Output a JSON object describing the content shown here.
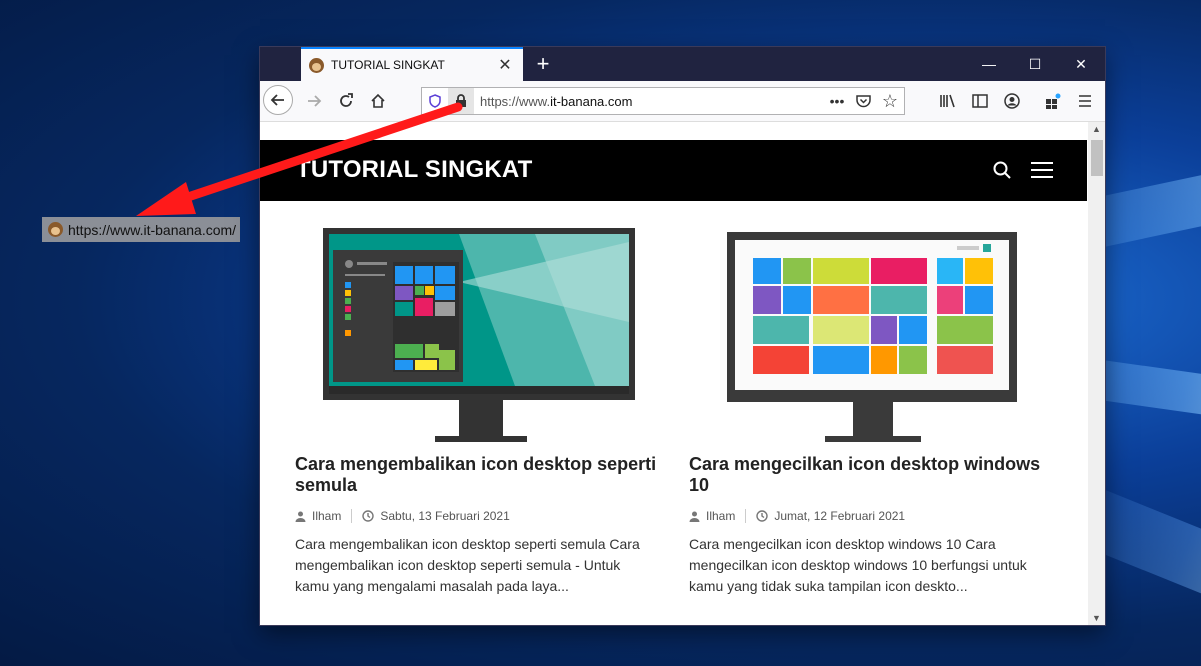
{
  "drag_link": {
    "url": "https://www.it-banana.com/"
  },
  "browser": {
    "tab": {
      "title": "TUTORIAL SINGKAT"
    },
    "url": {
      "scheme": "https://www.",
      "host": "it-banana.com"
    }
  },
  "site": {
    "title": "TUTORIAL SINGKAT",
    "posts": [
      {
        "title": "Cara mengembalikan icon desktop seperti semula",
        "author": "Ilham",
        "date": "Sabtu, 13 Februari 2021",
        "excerpt": "Cara mengembalikan icon desktop seperti semula Cara mengembalikan icon desktop seperti semula - Untuk kamu yang mengalami masalah pada laya..."
      },
      {
        "title": "Cara mengecilkan icon desktop windows 10",
        "author": "Ilham",
        "date": "Jumat, 12 Februari 2021",
        "excerpt": "Cara mengecilkan icon desktop windows 10 Cara mengecilkan icon desktop windows 10 berfungsi untuk kamu yang tidak suka tampilan icon deskto..."
      }
    ]
  },
  "colors": {
    "accent": "#0a84ff",
    "annotation_arrow": "#ff1a1a",
    "site_header": "#000000"
  },
  "icons": [
    "back-icon",
    "forward-icon",
    "reload-icon",
    "home-icon",
    "shield-icon",
    "lock-icon",
    "more-icon",
    "pocket-icon",
    "star-icon",
    "library-icon",
    "sidebar-icon",
    "account-icon",
    "extensions-icon",
    "menu-icon",
    "search-icon",
    "hamburger-icon"
  ]
}
